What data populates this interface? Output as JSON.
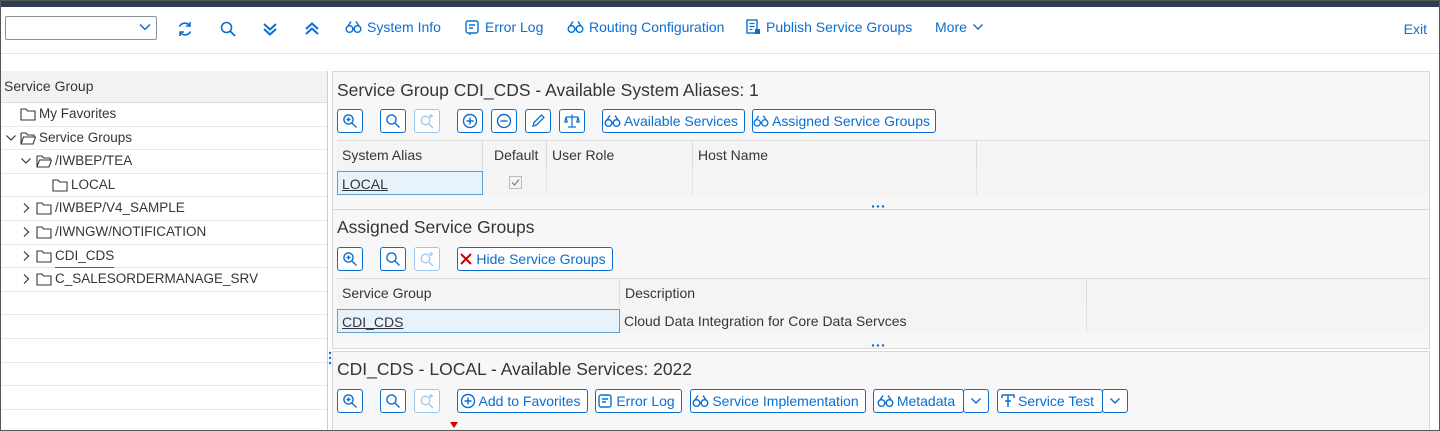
{
  "toolbar": {
    "select_value": "",
    "system_info": "System Info",
    "error_log": "Error Log",
    "routing_config": "Routing Configuration",
    "publish": "Publish Service Groups",
    "more": "More",
    "exit": "Exit"
  },
  "left_panel": {
    "header": "Service Group",
    "items": [
      {
        "label": "My Favorites"
      },
      {
        "label": "Service Groups"
      },
      {
        "label": "/IWBEP/TEA"
      },
      {
        "label": "LOCAL"
      },
      {
        "label": "/IWBEP/V4_SAMPLE"
      },
      {
        "label": "/IWNGW/NOTIFICATION"
      },
      {
        "label": "CDI_CDS"
      },
      {
        "label": "C_SALESORDERMANAGE_SRV"
      }
    ]
  },
  "aliases": {
    "title": "Service Group CDI_CDS - Available System Aliases: 1",
    "available_services": "Available Services",
    "assigned_service_groups": "Assigned Service Groups",
    "columns": [
      "System Alias",
      "Default",
      "User Role",
      "Host Name"
    ],
    "row": {
      "system_alias": "LOCAL"
    }
  },
  "assigned": {
    "title": "Assigned Service Groups",
    "hide_button": "Hide Service Groups",
    "columns": [
      "Service Group",
      "Description"
    ],
    "row": {
      "service_group": "CDI_CDS",
      "description": "Cloud Data Integration for Core Data Servces"
    }
  },
  "services": {
    "title": "CDI_CDS - LOCAL - Available Services: 2022",
    "add_favorites": "Add to Favorites",
    "error_log": "Error Log",
    "service_impl": "Service Implementation",
    "metadata": "Metadata",
    "service_test": "Service Test"
  },
  "colors": {
    "accent": "#0a6ed1",
    "dark_bar": "#2d3e50",
    "delete_red": "#cc0000"
  }
}
